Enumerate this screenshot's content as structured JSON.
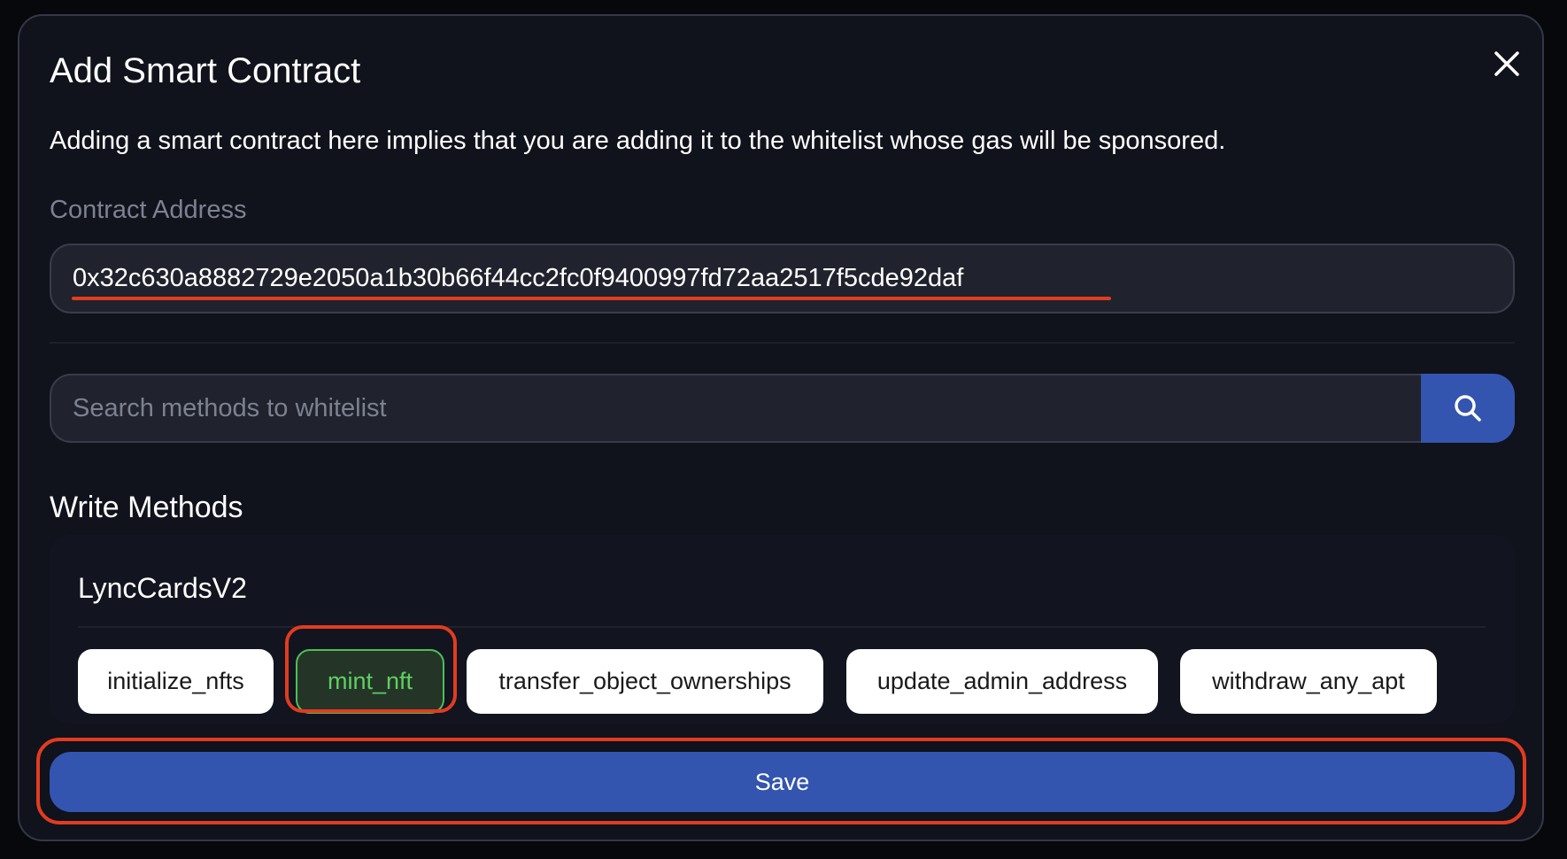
{
  "modal": {
    "title": "Add Smart Contract",
    "description": "Adding a smart contract here implies that you are adding it to the whitelist whose gas will be sponsored.",
    "contract_label": "Contract Address",
    "contract_address": "0x32c630a8882729e2050a1b30b66f44cc2fc0f9400997fd72aa2517f5cde92daf",
    "search_placeholder": "Search methods to whitelist",
    "write_methods_heading": "Write Methods",
    "contract_name": "LyncCardsV2",
    "methods": [
      {
        "label": "initialize_nfts",
        "selected": false
      },
      {
        "label": "mint_nft",
        "selected": true
      },
      {
        "label": "transfer_object_ownerships",
        "selected": false
      },
      {
        "label": "update_admin_address",
        "selected": false
      },
      {
        "label": "withdraw_any_apt",
        "selected": false
      }
    ],
    "save_label": "Save"
  },
  "colors": {
    "accent": "#3355b0",
    "selected": "#4fbf56",
    "highlight": "#e23b20",
    "background": "#10121c"
  }
}
